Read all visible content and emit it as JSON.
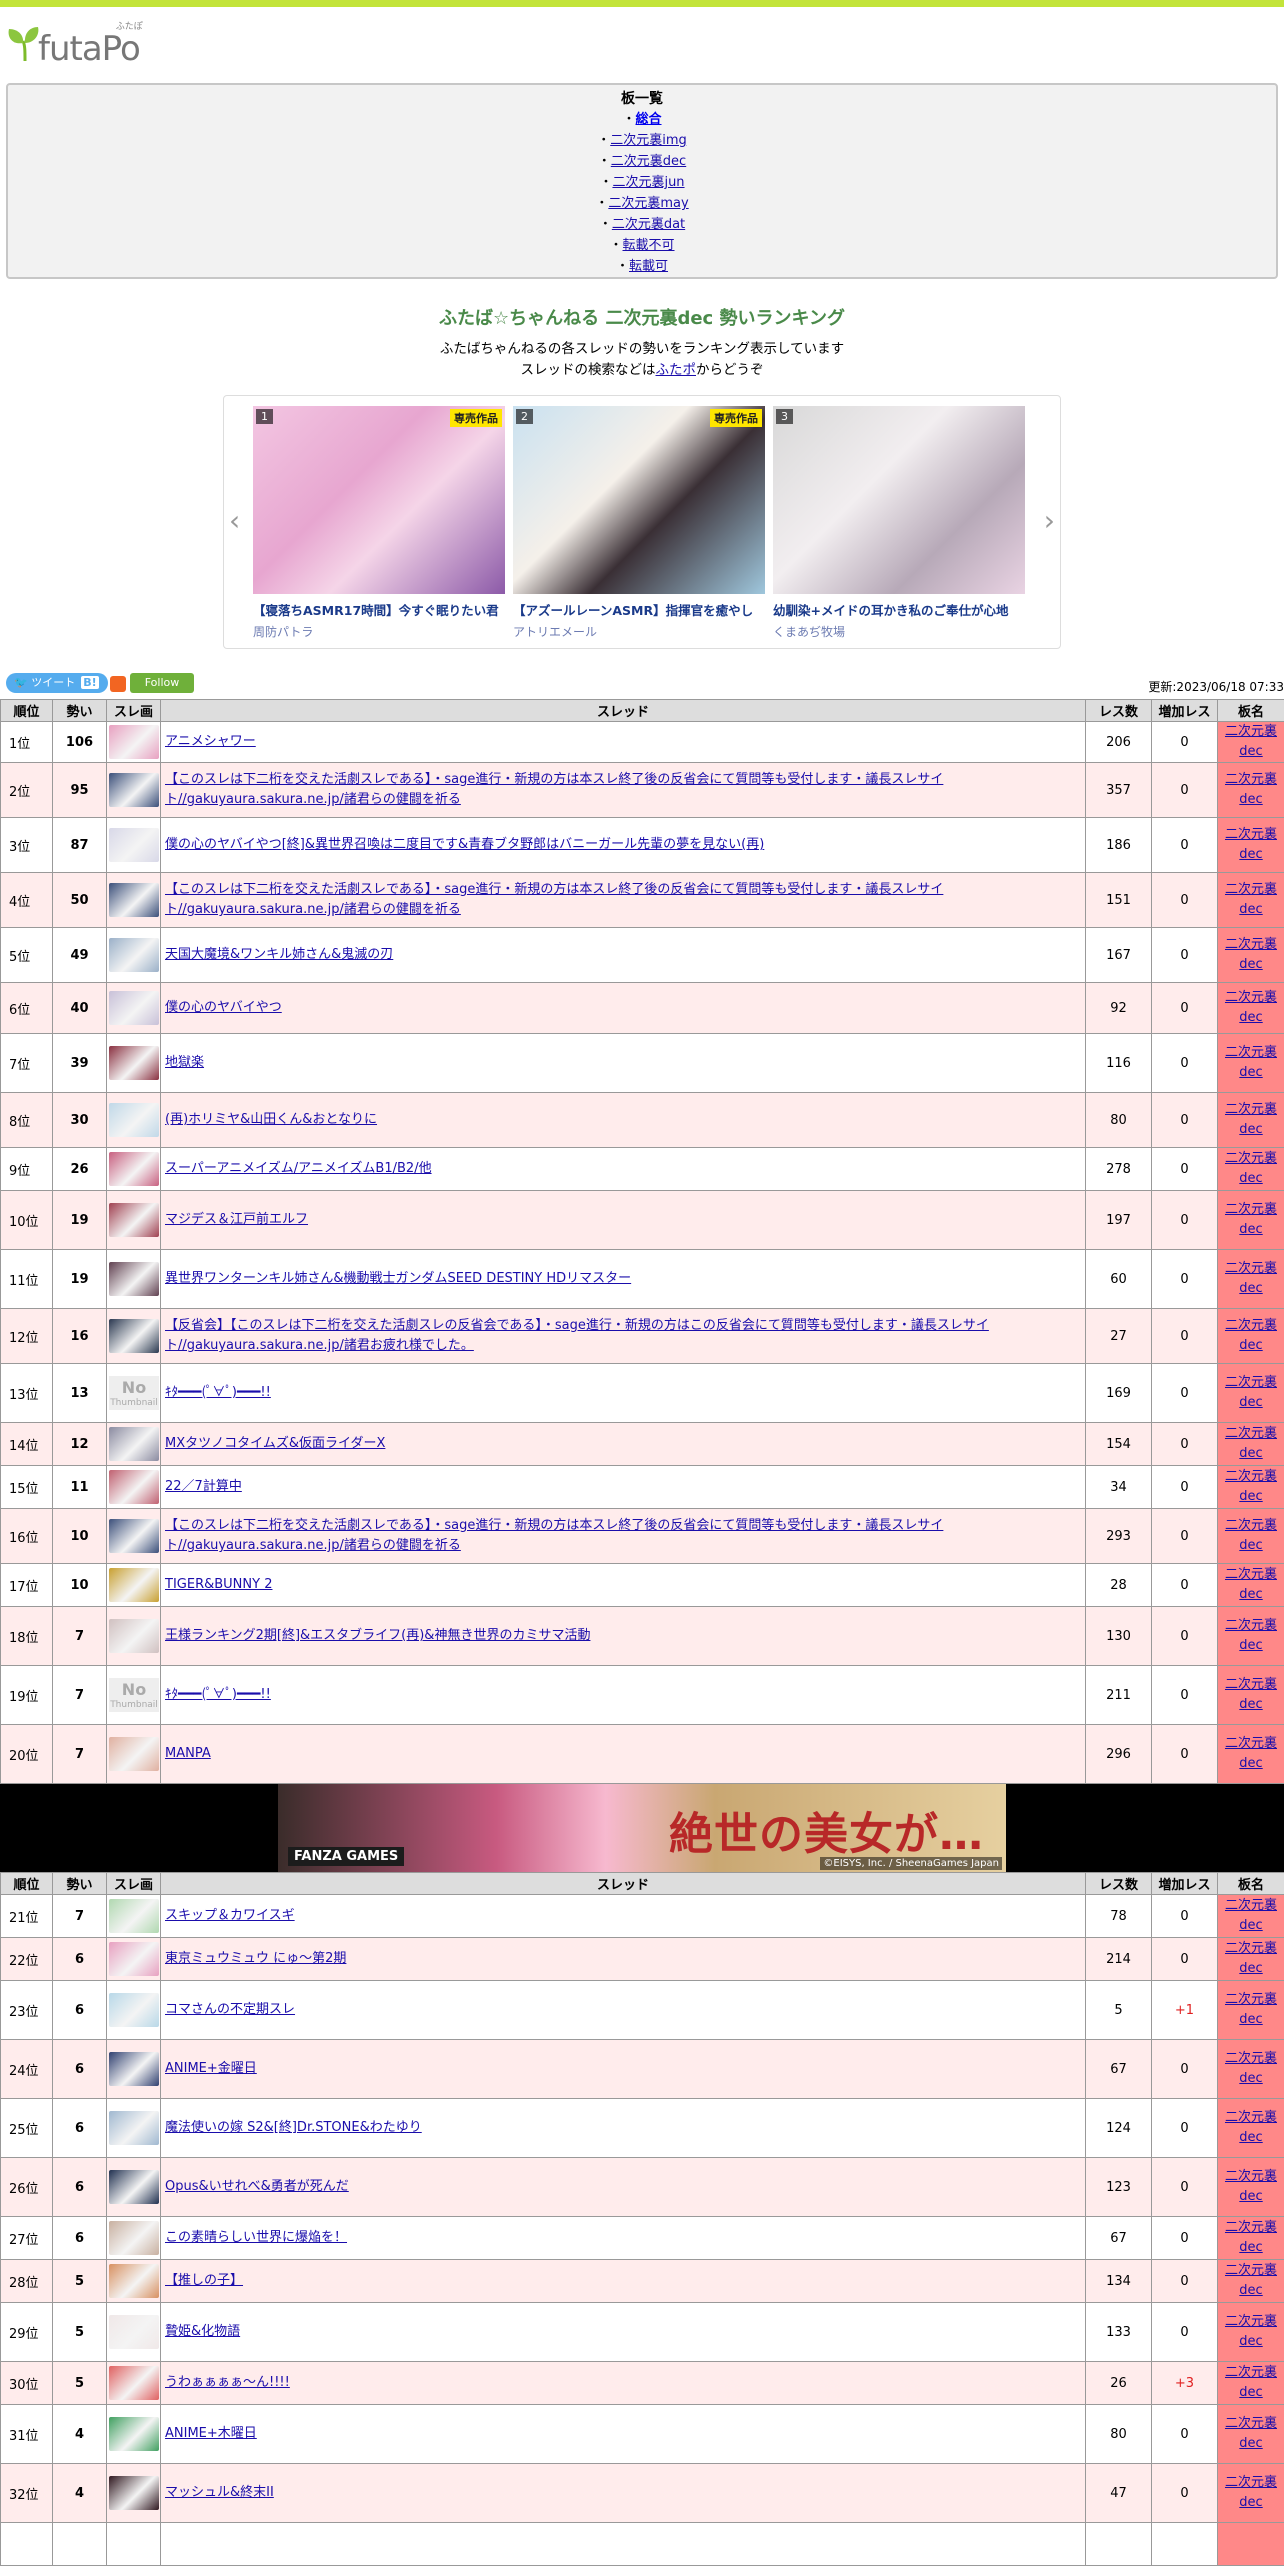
{
  "site": {
    "logo_text": "futaPo",
    "logo_ruby": "ふたぽ"
  },
  "boards": {
    "heading": "板一覧",
    "items": [
      {
        "label": "総合",
        "current": true
      },
      {
        "label": "二次元裏img"
      },
      {
        "label": "二次元裏dec"
      },
      {
        "label": "二次元裏jun"
      },
      {
        "label": "二次元裏may"
      },
      {
        "label": "二次元裏dat"
      },
      {
        "label": "転載不可"
      },
      {
        "label": "転載可"
      }
    ]
  },
  "page": {
    "title": "ふたば☆ちゃんねる 二次元裏dec 勢いランキング",
    "desc1": "ふたばちゃんねるの各スレッドの勢いをランキング表示しています",
    "desc2_pre": "スレッドの検索などは",
    "desc2_link": "ふたポ",
    "desc2_post": "からどうぞ"
  },
  "carousel": [
    {
      "num": "1",
      "tag": "専売作品",
      "title": "【寝落ちASMR17時間】今すぐ眠りたい君",
      "circle": "周防パトラ"
    },
    {
      "num": "2",
      "tag": "専売作品",
      "title": "【アズールレーンASMR】指揮官を癒やし",
      "circle": "アトリエメール"
    },
    {
      "num": "3",
      "tag": "",
      "title": "幼馴染+メイドの耳かき私のご奉仕が心地",
      "circle": "くまあぢ牧場"
    }
  ],
  "social": {
    "tweet": "ツイート",
    "follow": "Follow",
    "updated": "更新:2023/06/18 07:33"
  },
  "table": {
    "headers": [
      "順位",
      "勢い",
      "スレ画",
      "スレッド",
      "レス数",
      "増加レス",
      "板名"
    ],
    "rows": [
      {
        "rank": "1位",
        "ikioi": "106",
        "title": "アニメシャワー",
        "res": "206",
        "inc": "0",
        "board": "二次元裏dec"
      },
      {
        "rank": "2位",
        "ikioi": "95",
        "title": "【このスレは下二桁を交えた活劇スレである】・sage進行・新規の方は本スレ終了後の反省会にて質問等も受付します・議長スレサイト//gakuyaura.sakura.ne.jp/諸君らの健闘を祈る",
        "res": "357",
        "inc": "0",
        "board": "二次元裏dec"
      },
      {
        "rank": "3位",
        "ikioi": "87",
        "title": "僕の心のヤバイやつ[終]&異世界召喚は二度目です&青春ブタ野郎はバニーガール先輩の夢を見ない(再)",
        "res": "186",
        "inc": "0",
        "board": "二次元裏dec"
      },
      {
        "rank": "4位",
        "ikioi": "50",
        "title": "【このスレは下二桁を交えた活劇スレである】・sage進行・新規の方は本スレ終了後の反省会にて質問等も受付します・議長スレサイト//gakuyaura.sakura.ne.jp/諸君らの健闘を祈る",
        "res": "151",
        "inc": "0",
        "board": "二次元裏dec"
      },
      {
        "rank": "5位",
        "ikioi": "49",
        "title": "天国大魔境&ワンキル姉さん&鬼滅の刃",
        "res": "167",
        "inc": "0",
        "board": "二次元裏dec"
      },
      {
        "rank": "6位",
        "ikioi": "40",
        "title": "僕の心のヤバイやつ",
        "res": "92",
        "inc": "0",
        "board": "二次元裏dec"
      },
      {
        "rank": "7位",
        "ikioi": "39",
        "title": "地獄楽",
        "res": "116",
        "inc": "0",
        "board": "二次元裏dec"
      },
      {
        "rank": "8位",
        "ikioi": "30",
        "title": "(再)ホリミヤ&山田くん&おとなりに",
        "res": "80",
        "inc": "0",
        "board": "二次元裏dec"
      },
      {
        "rank": "9位",
        "ikioi": "26",
        "title": "スーパーアニメイズム/アニメイズムB1/B2/他",
        "res": "278",
        "inc": "0",
        "board": "二次元裏dec"
      },
      {
        "rank": "10位",
        "ikioi": "19",
        "title": "マジデス＆江戸前エルフ",
        "res": "197",
        "inc": "0",
        "board": "二次元裏dec"
      },
      {
        "rank": "11位",
        "ikioi": "19",
        "title": "異世界ワンターンキル姉さん&機動戦士ガンダムSEED DESTINY HDリマスター",
        "res": "60",
        "inc": "0",
        "board": "二次元裏dec"
      },
      {
        "rank": "12位",
        "ikioi": "16",
        "title": "【反省会】【このスレは下二桁を交えた活劇スレの反省会である】・sage進行・新規の方はこの反省会にて質問等も受付します・議長スレサイト//gakuyaura.sakura.ne.jp/諸君お疲れ様でした。",
        "res": "27",
        "inc": "0",
        "board": "二次元裏dec"
      },
      {
        "rank": "13位",
        "ikioi": "13",
        "title": "ｷﾀ━━━(ﾟ∀ﾟ)━━━!!",
        "res": "169",
        "inc": "0",
        "board": "二次元裏dec",
        "nothumb": true
      },
      {
        "rank": "14位",
        "ikioi": "12",
        "title": "MXタツノコタイムズ&仮面ライダーX",
        "res": "154",
        "inc": "0",
        "board": "二次元裏dec"
      },
      {
        "rank": "15位",
        "ikioi": "11",
        "title": "22／7計算中",
        "res": "34",
        "inc": "0",
        "board": "二次元裏dec"
      },
      {
        "rank": "16位",
        "ikioi": "10",
        "title": "【このスレは下二桁を交えた活劇スレである】・sage進行・新規の方は本スレ終了後の反省会にて質問等も受付します・議長スレサイト//gakuyaura.sakura.ne.jp/諸君らの健闘を祈る",
        "res": "293",
        "inc": "0",
        "board": "二次元裏dec"
      },
      {
        "rank": "17位",
        "ikioi": "10",
        "title": "TIGER&BUNNY 2",
        "res": "28",
        "inc": "0",
        "board": "二次元裏dec"
      },
      {
        "rank": "18位",
        "ikioi": "7",
        "title": "王様ランキング2期[終]&エスタブライフ(再)&神無き世界のカミサマ活動",
        "res": "130",
        "inc": "0",
        "board": "二次元裏dec"
      },
      {
        "rank": "19位",
        "ikioi": "7",
        "title": "ｷﾀ━━━(ﾟ∀ﾟ)━━━!!",
        "res": "211",
        "inc": "0",
        "board": "二次元裏dec",
        "nothumb": true
      },
      {
        "rank": "20位",
        "ikioi": "7",
        "title": "MANPA",
        "res": "296",
        "inc": "0",
        "board": "二次元裏dec"
      }
    ],
    "rows2": [
      {
        "rank": "21位",
        "ikioi": "7",
        "title": "スキップ＆カワイスギ",
        "res": "78",
        "inc": "0",
        "board": "二次元裏dec"
      },
      {
        "rank": "22位",
        "ikioi": "6",
        "title": "東京ミュウミュウ にゅ～第2期",
        "res": "214",
        "inc": "0",
        "board": "二次元裏dec"
      },
      {
        "rank": "23位",
        "ikioi": "6",
        "title": "コマさんの不定期スレ",
        "res": "5",
        "inc": "+1",
        "board": "二次元裏dec"
      },
      {
        "rank": "24位",
        "ikioi": "6",
        "title": "ANIME+金曜日",
        "res": "67",
        "inc": "0",
        "board": "二次元裏dec"
      },
      {
        "rank": "25位",
        "ikioi": "6",
        "title": "魔法使いの嫁 S2&[終]Dr.STONE&わたゆり",
        "res": "124",
        "inc": "0",
        "board": "二次元裏dec"
      },
      {
        "rank": "26位",
        "ikioi": "6",
        "title": "Opus&いせれべ&勇者が死んだ",
        "res": "123",
        "inc": "0",
        "board": "二次元裏dec"
      },
      {
        "rank": "27位",
        "ikioi": "6",
        "title": "この素晴らしい世界に爆焔を！",
        "res": "67",
        "inc": "0",
        "board": "二次元裏dec"
      },
      {
        "rank": "28位",
        "ikioi": "5",
        "title": "【推しの子】",
        "res": "134",
        "inc": "0",
        "board": "二次元裏dec"
      },
      {
        "rank": "29位",
        "ikioi": "5",
        "title": "贄姫&化物語",
        "res": "133",
        "inc": "0",
        "board": "二次元裏dec"
      },
      {
        "rank": "30位",
        "ikioi": "5",
        "title": "うわぁぁぁぁ～ん!!!!",
        "res": "26",
        "inc": "+3",
        "board": "二次元裏dec"
      },
      {
        "rank": "31位",
        "ikioi": "4",
        "title": "ANIME+木曜日",
        "res": "80",
        "inc": "0",
        "board": "二次元裏dec"
      },
      {
        "rank": "32位",
        "ikioi": "4",
        "title": "マッシュル&終末II",
        "res": "47",
        "inc": "0",
        "board": "二次元裏dec"
      },
      {
        "rank": "",
        "ikioi": "",
        "title": "",
        "res": "",
        "inc": "",
        "board": ""
      }
    ]
  },
  "ad": {
    "logo": "FANZA GAMES",
    "text": "絶世の美女が…",
    "copy": "©EISYS, Inc. / SheenaGames Japan"
  }
}
